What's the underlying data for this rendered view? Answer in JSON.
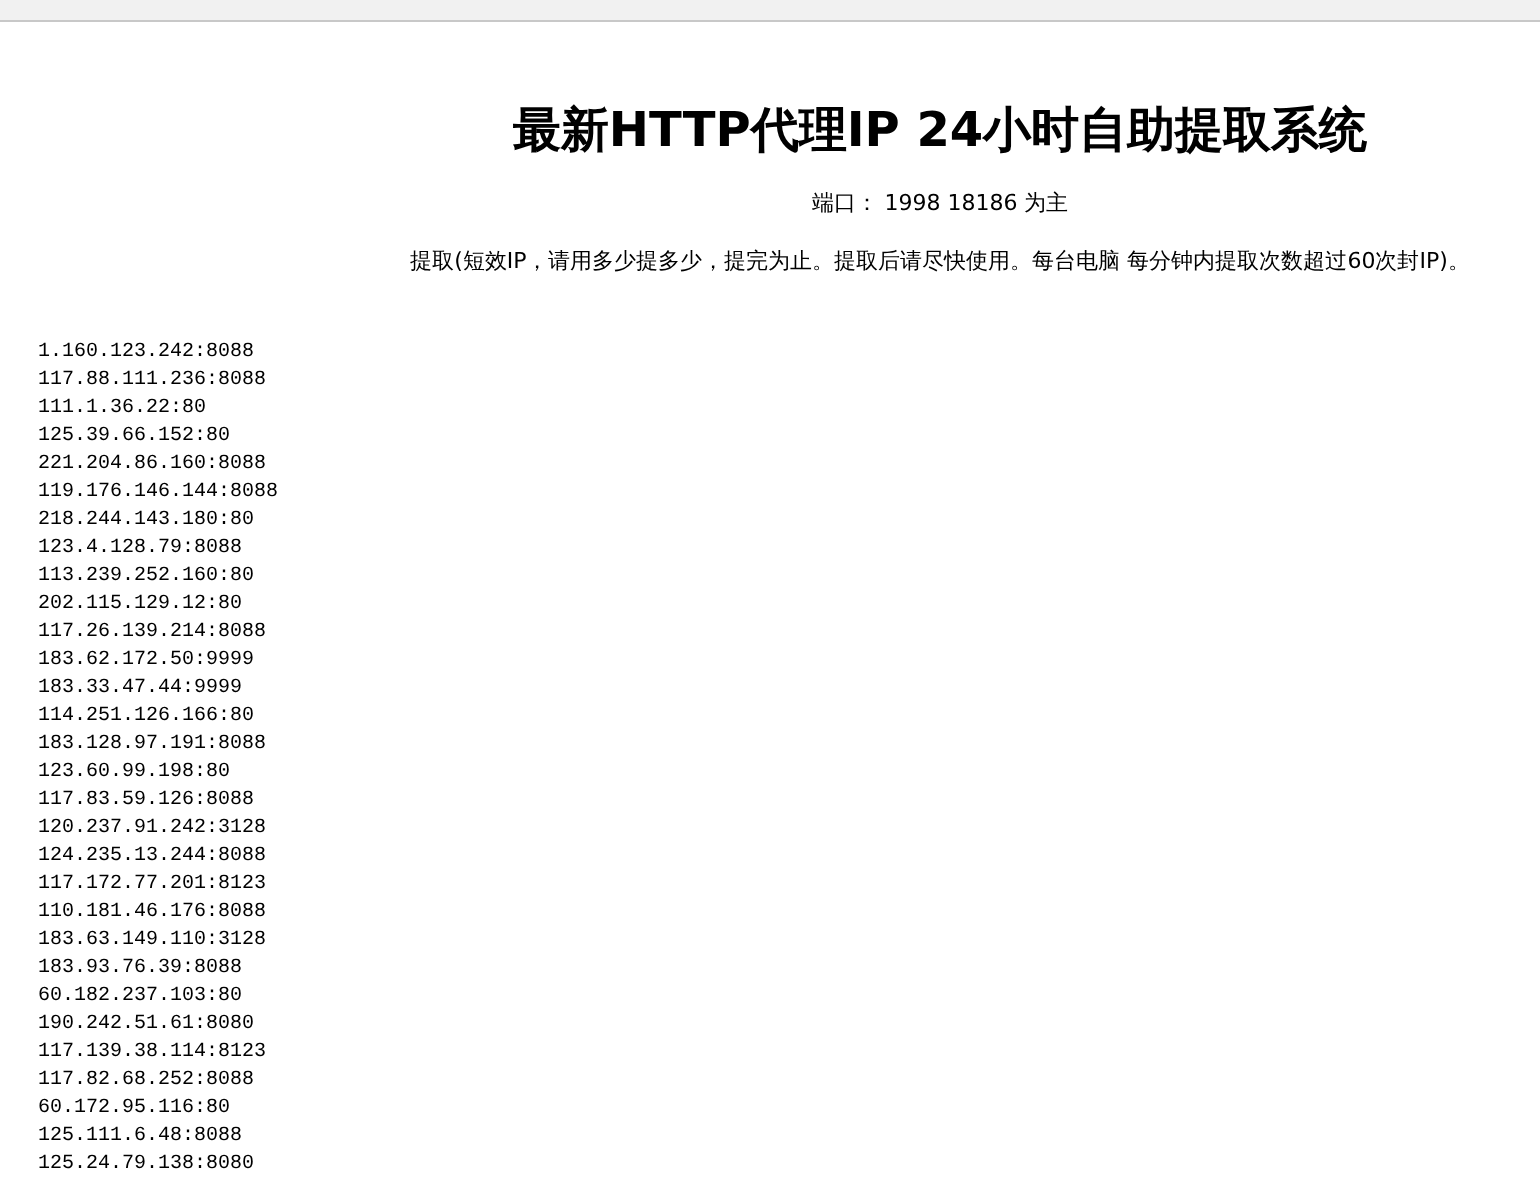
{
  "title": "最新HTTP代理IP 24小时自助提取系统",
  "port_note": "端口： 1998 18186 为主",
  "notice": "提取(短效IP，请用多少提多少，提完为止。提取后请尽快使用。每台电脑 每分钟内提取次数超过60次封IP)。",
  "proxies": [
    "1.160.123.242:8088",
    "117.88.111.236:8088",
    "111.1.36.22:80",
    "125.39.66.152:80",
    "221.204.86.160:8088",
    "119.176.146.144:8088",
    "218.244.143.180:80",
    "123.4.128.79:8088",
    "113.239.252.160:80",
    "202.115.129.12:80",
    "117.26.139.214:8088",
    "183.62.172.50:9999",
    "183.33.47.44:9999",
    "114.251.126.166:80",
    "183.128.97.191:8088",
    "123.60.99.198:80",
    "117.83.59.126:8088",
    "120.237.91.242:3128",
    "124.235.13.244:8088",
    "117.172.77.201:8123",
    "110.181.46.176:8088",
    "183.63.149.110:3128",
    "183.93.76.39:8088",
    "60.182.237.103:80",
    "190.242.51.61:8080",
    "117.139.38.114:8123",
    "117.82.68.252:8088",
    "60.172.95.116:80",
    "125.111.6.48:8088",
    "125.24.79.138:8080"
  ]
}
